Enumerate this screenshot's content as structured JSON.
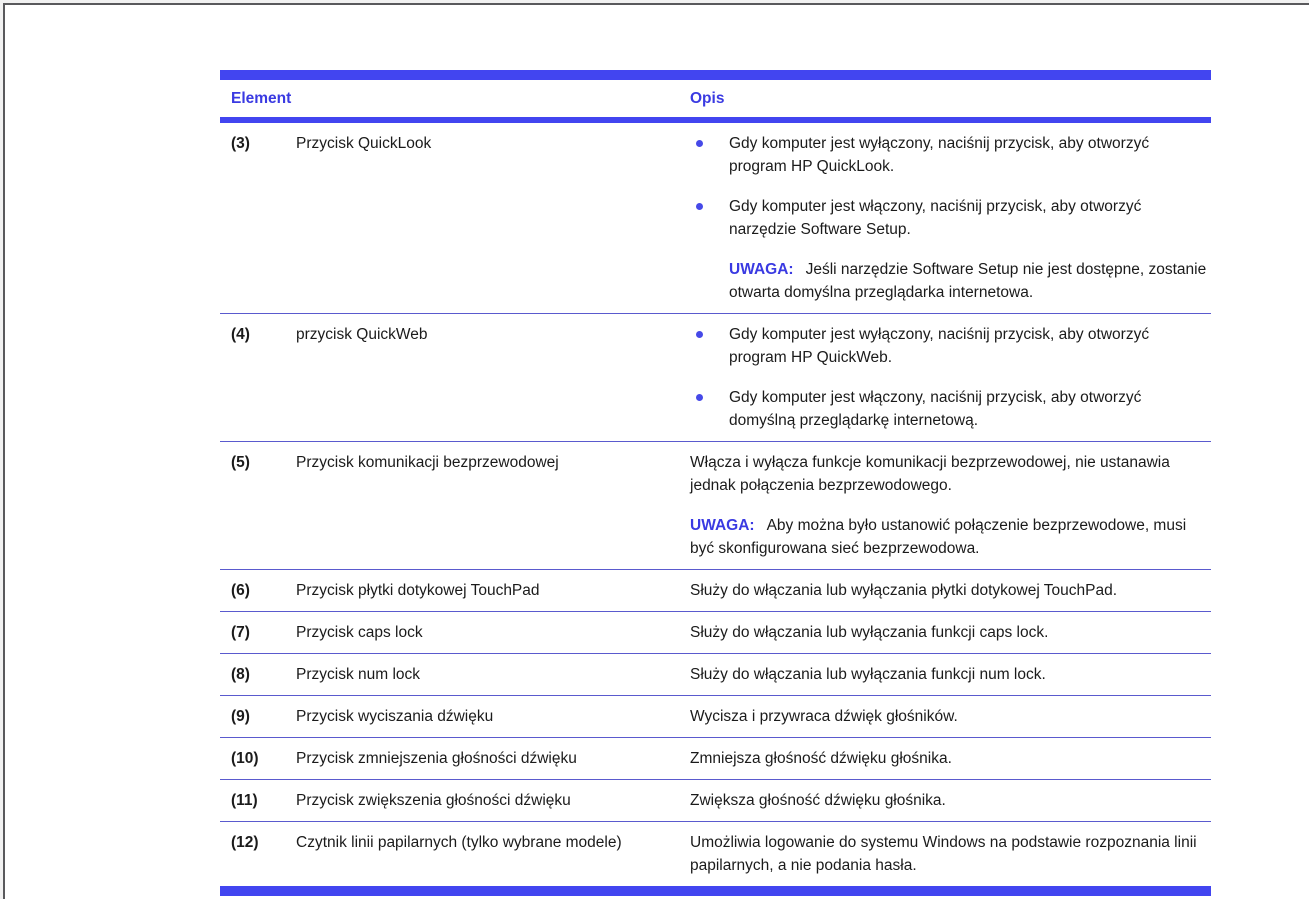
{
  "page": {
    "edge_border_color": "#59595c",
    "background": "#ffffff"
  },
  "table": {
    "accent_bar_color": "#4245f0",
    "separator_color": "#5a5ace",
    "header_text_color": "#3a3ae2",
    "bullet_color": "#4649e8",
    "note_label_color": "#3a3ae2",
    "note_label": "UWAGA:",
    "columns": {
      "element": "Element",
      "opis": "Opis"
    },
    "rows": [
      {
        "number": "(3)",
        "label": "Przycisk QuickLook",
        "bullets": [
          "Gdy komputer jest wyłączony, naciśnij przycisk, aby otworzyć program HP QuickLook.",
          "Gdy komputer jest włączony, naciśnij przycisk, aby otworzyć narzędzie Software Setup."
        ],
        "note": "Jeśli narzędzie Software Setup nie jest dostępne, zostanie otwarta domyślna przeglądarka internetowa.",
        "note_indent": true
      },
      {
        "number": "(4)",
        "label": "przycisk QuickWeb",
        "bullets": [
          "Gdy komputer jest wyłączony, naciśnij przycisk, aby otworzyć program HP QuickWeb.",
          "Gdy komputer jest włączony, naciśnij przycisk, aby otworzyć domyślną przeglądarkę internetową."
        ]
      },
      {
        "number": "(5)",
        "label": "Przycisk komunikacji bezprzewodowej",
        "text": "Włącza i wyłącza funkcje komunikacji bezprzewodowej, nie ustanawia jednak połączenia bezprzewodowego.",
        "note": "Aby można było ustanowić połączenie bezprzewodowe, musi być skonfigurowana sieć bezprzewodowa.",
        "note_indent": false
      },
      {
        "number": "(6)",
        "label": "Przycisk płytki dotykowej TouchPad",
        "text": "Służy do włączania lub wyłączania płytki dotykowej TouchPad."
      },
      {
        "number": "(7)",
        "label": "Przycisk caps lock",
        "text": "Służy do włączania lub wyłączania funkcji caps lock."
      },
      {
        "number": "(8)",
        "label": "Przycisk num lock",
        "text": "Służy do włączania lub wyłączania funkcji num lock."
      },
      {
        "number": "(9)",
        "label": "Przycisk wyciszania dźwięku",
        "text": "Wycisza i przywraca dźwięk głośników."
      },
      {
        "number": "(10)",
        "label": "Przycisk zmniejszenia głośności dźwięku",
        "text": "Zmniejsza głośność dźwięku głośnika."
      },
      {
        "number": "(11)",
        "label": "Przycisk zwiększenia głośności dźwięku",
        "text": "Zwiększa głośność dźwięku głośnika."
      },
      {
        "number": "(12)",
        "label": "Czytnik linii papilarnych (tylko wybrane modele)",
        "text": "Umożliwia logowanie do systemu Windows na podstawie rozpoznania linii papilarnych, a nie podania hasła."
      }
    ]
  }
}
